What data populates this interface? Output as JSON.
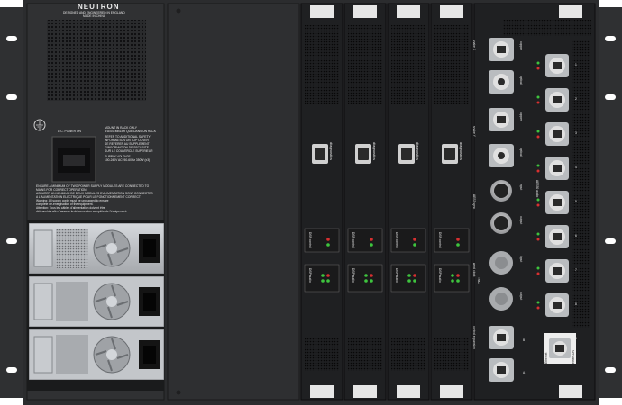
{
  "brand": "NEUTRON",
  "brand_sub1": "DESIGNED AND ENGINEERED IN ENGLAND",
  "brand_sub2": "MADE IN CHINA",
  "power_label": "D.C. POWER ON",
  "notice_lines": [
    "MOUNT IN RACK ONLY",
    "N'ASSEMBLER QUE DANS UN RACK",
    "REFER TO ADDITIONAL SAFETY",
    "INFORMATION ON TOP COVER",
    "SE REFERER AU SUPPLEMENT",
    "D'INFORMATION DE SECURITE",
    "SUR LE COUVERCLE SUPERIEUR",
    "SUPPLY VOLTAGE",
    "100-240V  AC~50-60Hz 350W (x3)"
  ],
  "warning_lines": [
    "ENSURE A MINIMUM OF TWO POWER SUPPLY MODULES ARE CONNECTED TO",
    "MAINS FOR CORRECT OPERATION",
    "ASSURER UN MINIMUM DE DEUX MODULES D'ALIMENTATION SONT CONNECTES",
    "A L'ALIMENTATION ELECTRIQUE POUR LE FONCTIONNEMENT CORRECT",
    "Warning: All supply cords must be unplugged to ensure",
    "complete de-energisation of the equipment.",
    "Attention: Tous les câbles d'alimentation doivent être",
    "débranchés afin d'assurer la déconnection complète de l'équipement."
  ],
  "dsp_card": {
    "diagnostics": "diagnostics",
    "control": "DSP control",
    "audio": "DSP audio"
  },
  "io_labels": {
    "snake_x": "snake X",
    "snake_y": "snake Y",
    "copper": "copper",
    "optical": "optical",
    "aes3_sync": "AES3 sync",
    "input": "input",
    "output": "output",
    "word_clock": "word clock",
    "tnc": "TNC",
    "control_expansion": "control expansion",
    "port_a": "A",
    "port_b": "B",
    "aes50_audio": "AES50 audio",
    "ethernet": "Ethernet",
    "ethercon": "etherCON",
    "aes50_numbers": [
      "1",
      "2",
      "3",
      "4",
      "5",
      "6",
      "7",
      "8",
      "9"
    ]
  },
  "colors": {
    "chassis": "#2b2c2e",
    "rack_ear": "#2f3032",
    "panel": "#3a3b3d",
    "card": "#1f2022",
    "label_white": "#e8e8e8",
    "led_green": "#3ec43e",
    "led_red": "#d83030",
    "psu_metal": "#bfc2c6"
  }
}
